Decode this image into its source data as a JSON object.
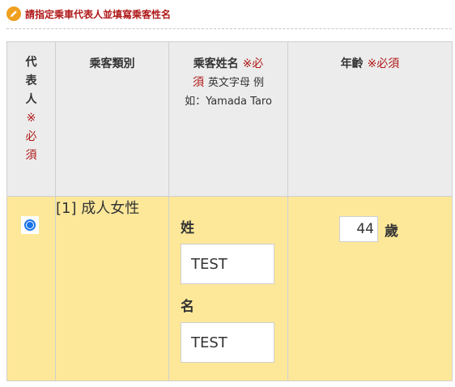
{
  "section": {
    "title": "請指定乘車代表人並填寫乘客性名",
    "icon": "pencil-icon"
  },
  "table": {
    "headers": {
      "representative": {
        "chars": [
          "代",
          "表",
          "人"
        ],
        "required_chars": [
          "※",
          "必",
          "須"
        ]
      },
      "passenger_type": "乘客類別",
      "name": {
        "label": "乘客姓名",
        "required": "※必",
        "required_tail": "須",
        "hint_line1": "英文字母 例",
        "hint_line2": "如：Yamada Taro"
      },
      "age": {
        "label": "年齡",
        "required": "※必須"
      }
    },
    "row": {
      "representative_selected": true,
      "passenger_type": "[1] 成人女性",
      "surname_label": "姓",
      "surname_value": "TEST",
      "given_name_label": "名",
      "given_name_value": "TEST",
      "age_value": "44",
      "age_unit": "歲"
    }
  },
  "colors": {
    "title_red": "#b01818",
    "row_yellow": "#fde89a",
    "header_gray": "#ececec",
    "radio_blue": "#1a73e8",
    "pencil_orange": "#f0a020"
  }
}
